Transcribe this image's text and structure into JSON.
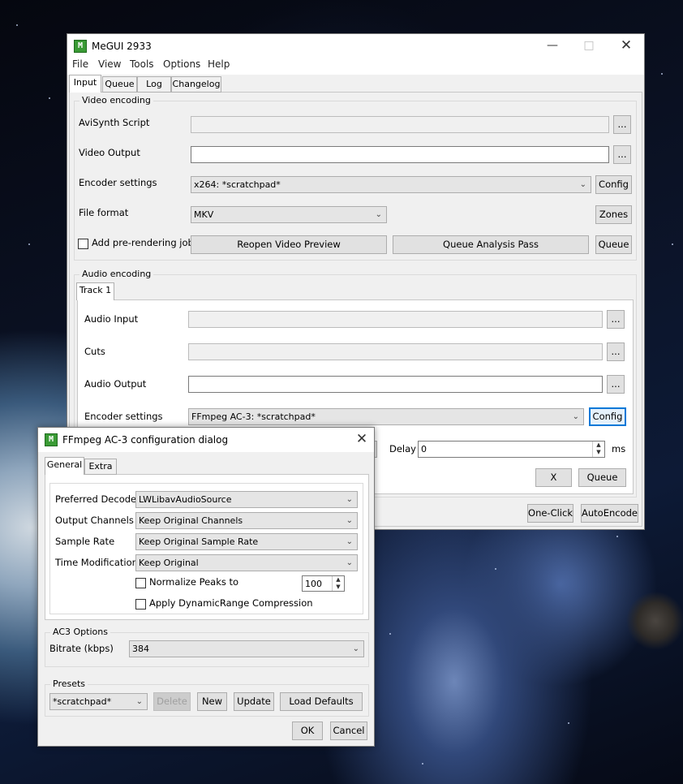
{
  "main_window": {
    "title": "MeGUI 2933",
    "icon": "megui-app-icon",
    "menu": [
      "File",
      "View",
      "Tools",
      "Options",
      "Help"
    ],
    "tabs": [
      "Input",
      "Queue",
      "Log",
      "Changelog"
    ],
    "video": {
      "group_title": "Video encoding",
      "avisynth_label": "AviSynth Script",
      "avisynth_value": "",
      "video_output_label": "Video Output",
      "video_output_value": "",
      "encoder_settings_label": "Encoder settings",
      "encoder_value": "x264: *scratchpad*",
      "config_label": "Config",
      "file_format_label": "File format",
      "file_format_value": "MKV",
      "zones_label": "Zones",
      "prerender_label": "Add pre-rendering job",
      "reopen_preview_label": "Reopen Video Preview",
      "queue_analysis_label": "Queue Analysis Pass",
      "queue_label": "Queue",
      "browse_label": "..."
    },
    "audio": {
      "group_title": "Audio encoding",
      "track_tab": "Track 1",
      "audio_input_label": "Audio Input",
      "cuts_label": "Cuts",
      "audio_output_label": "Audio Output",
      "encoder_settings_label": "Encoder settings",
      "encoder_value": "FFmpeg AC-3: *scratchpad*",
      "config_label": "Config",
      "delay_label": "Delay",
      "delay_value": "0",
      "ms_label": "ms",
      "x_label": "X",
      "queue_label": "Queue",
      "browse_label": "..."
    },
    "one_click_label": "One-Click",
    "autoencode_label": "AutoEncode"
  },
  "dialog": {
    "title": "FFmpeg AC-3 configuration dialog",
    "tabs": [
      "General",
      "Extra"
    ],
    "preferred_decoder_label": "Preferred Decoder",
    "preferred_decoder_value": "LWLibavAudioSource",
    "output_channels_label": "Output Channels",
    "output_channels_value": "Keep Original Channels",
    "sample_rate_label": "Sample Rate",
    "sample_rate_value": "Keep Original Sample Rate",
    "time_mod_label": "Time Modification",
    "time_mod_value": "Keep Original",
    "normalize_label": "Normalize Peaks to",
    "normalize_value": "100",
    "drc_label": "Apply DynamicRange Compression",
    "ac3_group_title": "AC3 Options",
    "bitrate_label": "Bitrate (kbps)",
    "bitrate_value": "384",
    "presets_group_title": "Presets",
    "preset_value": "*scratchpad*",
    "delete_label": "Delete",
    "new_label": "New",
    "update_label": "Update",
    "load_defaults_label": "Load Defaults",
    "ok_label": "OK",
    "cancel_label": "Cancel"
  }
}
